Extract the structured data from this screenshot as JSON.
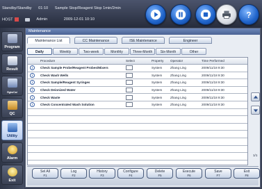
{
  "status": {
    "mode": "Standby/Standby",
    "time": "01:10",
    "message": "Sample Stop/Reagent Stop 1min/2min",
    "host_label": "HOST",
    "user": "Admin",
    "datetime": "2009-12-01 10:10"
  },
  "controls": [
    {
      "name": "play-button",
      "icon": "play-icon"
    },
    {
      "name": "pause-button",
      "icon": "pause-icon"
    },
    {
      "name": "stop-button",
      "icon": "stop-icon"
    },
    {
      "name": "print-button",
      "icon": "printer-icon"
    },
    {
      "name": "help-button",
      "icon": "help-icon"
    }
  ],
  "nav": [
    {
      "label": "Program",
      "icon": "program-icon"
    },
    {
      "label": "Result",
      "icon": "result-icon"
    },
    {
      "label": "Rgts/Cal",
      "icon": "reagent-icon"
    },
    {
      "label": "QC",
      "icon": "qc-icon"
    },
    {
      "label": "Utility",
      "icon": "utility-icon",
      "active": true
    },
    {
      "label": "Alarm",
      "icon": "alarm-icon"
    },
    {
      "label": "Exit",
      "icon": "exit-icon"
    }
  ],
  "panel_title": "Maintenance",
  "main_tabs": [
    "Maintenance List",
    "CC Maintenance",
    "ISE Maintenance",
    "Engineer"
  ],
  "sub_tabs": [
    "Daily",
    "Weekly",
    "Two-week",
    "Monthly",
    "Three-Month",
    "Six-Month",
    "Other"
  ],
  "table": {
    "headers": {
      "procedure": "Procedure",
      "select": "Select",
      "property": "Property",
      "operator": "Operator",
      "time": "Time Performed"
    },
    "rows": [
      {
        "procedure": "Check Sample Probe/Reagent Probes/Mixers",
        "property": "System",
        "operator": "Zhang Ling",
        "time": "2009/11/18 9:30"
      },
      {
        "procedure": "Check Wash Wells",
        "property": "System",
        "operator": "Zhang Ling",
        "time": "2009/11/18 9:30"
      },
      {
        "procedure": "Check Sample/Reagent Syringes",
        "property": "System",
        "operator": "Zhang Ling",
        "time": "2009/11/18 9:30"
      },
      {
        "procedure": "Check Deionized Water",
        "property": "System",
        "operator": "Zhang Ling",
        "time": "2009/11/18 9:30"
      },
      {
        "procedure": "Check Waste",
        "property": "System",
        "operator": "Zhang Ling",
        "time": "2009/11/18 9:30"
      },
      {
        "procedure": "Check Concentrated Wash Solution",
        "property": "System",
        "operator": "Zhang Ling",
        "time": "2009/11/18 9:30"
      }
    ],
    "page_count": "1/1"
  },
  "function_buttons": [
    {
      "label": "Sel All",
      "key": "F1"
    },
    {
      "label": "Log",
      "key": "F2"
    },
    {
      "label": "History",
      "key": "F3"
    },
    {
      "label": "Configure",
      "key": "F4"
    },
    {
      "label": "Delete",
      "key": "F5"
    },
    {
      "label": "Execute",
      "key": "F6"
    },
    {
      "label": "Save",
      "key": "F7"
    },
    {
      "label": "Exit",
      "key": "F8"
    }
  ]
}
